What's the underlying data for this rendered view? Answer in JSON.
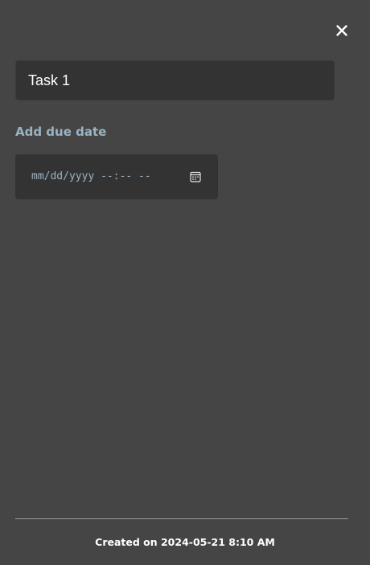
{
  "dialog": {
    "close_icon": "close-icon"
  },
  "task": {
    "title_value": "Task 1"
  },
  "due_date": {
    "label": "Add due date",
    "placeholder": "mm/dd/yyyy --:-- --",
    "calendar_icon": "calendar-icon"
  },
  "footer": {
    "created_text": "Created on 2024-05-21 8:10 AM"
  },
  "colors": {
    "background": "#454545",
    "field_background": "#333333",
    "accent_text": "#9bb3c1",
    "primary_text": "#ffffff",
    "divider": "#9a9a9a"
  }
}
